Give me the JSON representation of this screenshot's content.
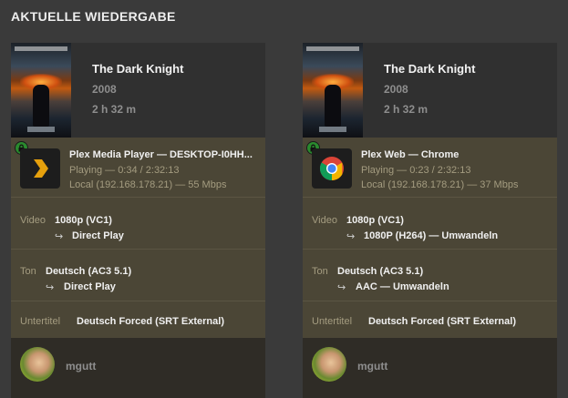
{
  "page": {
    "title": "AKTUELLE WIEDERGABE"
  },
  "sessions": [
    {
      "movie": {
        "title": "The Dark Knight",
        "year": "2008",
        "duration": "2 h 32 m"
      },
      "player": {
        "icon": "plex-icon",
        "name": "Plex Media Player  —  DESKTOP-I0HH...",
        "state": "Playing — 0:34 / 2:32:13",
        "network": "Local (192.168.178.21) — 55 Mbps"
      },
      "video": {
        "label": "Video",
        "value": "1080p (VC1)",
        "transcode": "Direct Play"
      },
      "audio": {
        "label": "Ton",
        "value": "Deutsch (AC3 5.1)",
        "transcode": "Direct Play"
      },
      "subtitle": {
        "label": "Untertitel",
        "value": "Deutsch Forced (SRT External)"
      },
      "user": {
        "name": "mgutt"
      }
    },
    {
      "movie": {
        "title": "The Dark Knight",
        "year": "2008",
        "duration": "2 h 32 m"
      },
      "player": {
        "icon": "chrome-icon",
        "name": "Plex Web  —  Chrome",
        "state": "Playing — 0:23 / 2:32:13",
        "network": "Local (192.168.178.21) — 37 Mbps"
      },
      "video": {
        "label": "Video",
        "value": "1080p (VC1)",
        "transcode": "1080P (H264) — Umwandeln"
      },
      "audio": {
        "label": "Ton",
        "value": "Deutsch (AC3 5.1)",
        "transcode": "AAC — Umwandeln"
      },
      "subtitle": {
        "label": "Untertitel",
        "value": "Deutsch Forced (SRT External)"
      },
      "user": {
        "name": "mgutt"
      }
    }
  ],
  "symbols": {
    "arrow": "↪"
  },
  "colors": {
    "card_bg": "#4b4636",
    "head_bg": "#303030",
    "user_bg": "#2f2c26",
    "lock": "#2a8a2e",
    "plex_accent": "#e5a00d"
  }
}
